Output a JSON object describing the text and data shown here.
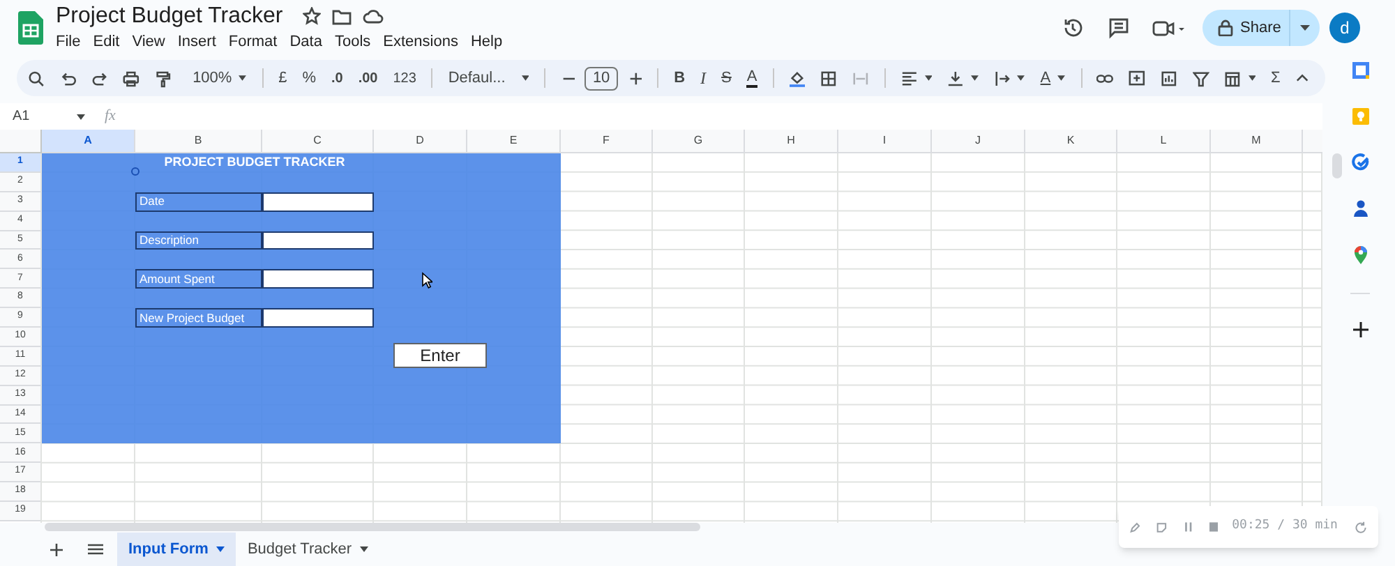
{
  "document": {
    "title": "Project Budget Tracker"
  },
  "menu": [
    "File",
    "Edit",
    "View",
    "Insert",
    "Format",
    "Data",
    "Tools",
    "Extensions",
    "Help"
  ],
  "share": {
    "label": "Share"
  },
  "account": {
    "initial": "d"
  },
  "toolbar": {
    "zoom": "100%",
    "currency": "£",
    "percent": "%",
    "decrease_decimal": ".0",
    "increase_decimal": ".00",
    "number_format": "123",
    "font": "Defaul...",
    "font_size": "10",
    "bold": "B",
    "italic": "I",
    "strikethrough": "S",
    "text_color": "A",
    "text_rotation": "A",
    "sum": "Σ"
  },
  "formula_bar": {
    "cell": "A1",
    "fx": "fx"
  },
  "columns": [
    {
      "label": "A",
      "selected": true
    },
    {
      "label": "B",
      "selected": false
    },
    {
      "label": "C",
      "selected": false
    },
    {
      "label": "D",
      "selected": false
    },
    {
      "label": "E",
      "selected": false
    },
    {
      "label": "F",
      "selected": false
    },
    {
      "label": "G",
      "selected": false
    },
    {
      "label": "H",
      "selected": false
    },
    {
      "label": "I",
      "selected": false
    },
    {
      "label": "J",
      "selected": false
    },
    {
      "label": "K",
      "selected": false
    },
    {
      "label": "L",
      "selected": false
    },
    {
      "label": "M",
      "selected": false
    }
  ],
  "rows": [
    {
      "label": "1",
      "selected": true
    },
    {
      "label": "2",
      "selected": false
    },
    {
      "label": "3",
      "selected": false
    },
    {
      "label": "4",
      "selected": false
    },
    {
      "label": "5",
      "selected": false
    },
    {
      "label": "6",
      "selected": false
    },
    {
      "label": "7",
      "selected": false
    },
    {
      "label": "8",
      "selected": false
    },
    {
      "label": "9",
      "selected": false
    },
    {
      "label": "10",
      "selected": false
    },
    {
      "label": "11",
      "selected": false
    },
    {
      "label": "12",
      "selected": false
    },
    {
      "label": "13",
      "selected": false
    },
    {
      "label": "14",
      "selected": false
    },
    {
      "label": "15",
      "selected": false
    },
    {
      "label": "16",
      "selected": false
    },
    {
      "label": "17",
      "selected": false
    },
    {
      "label": "18",
      "selected": false
    },
    {
      "label": "19",
      "selected": false
    }
  ],
  "form": {
    "title": "PROJECT BUDGET TRACKER",
    "fields": [
      {
        "label": "Date"
      },
      {
        "label": "Description"
      },
      {
        "label": "Amount Spent"
      },
      {
        "label": "New Project Budget"
      }
    ],
    "button": "Enter"
  },
  "sheet_tabs": [
    {
      "label": "Input Form",
      "selected": true
    },
    {
      "label": "Budget Tracker",
      "selected": false
    }
  ],
  "recorder": {
    "time": "00:25 / 30 min"
  }
}
